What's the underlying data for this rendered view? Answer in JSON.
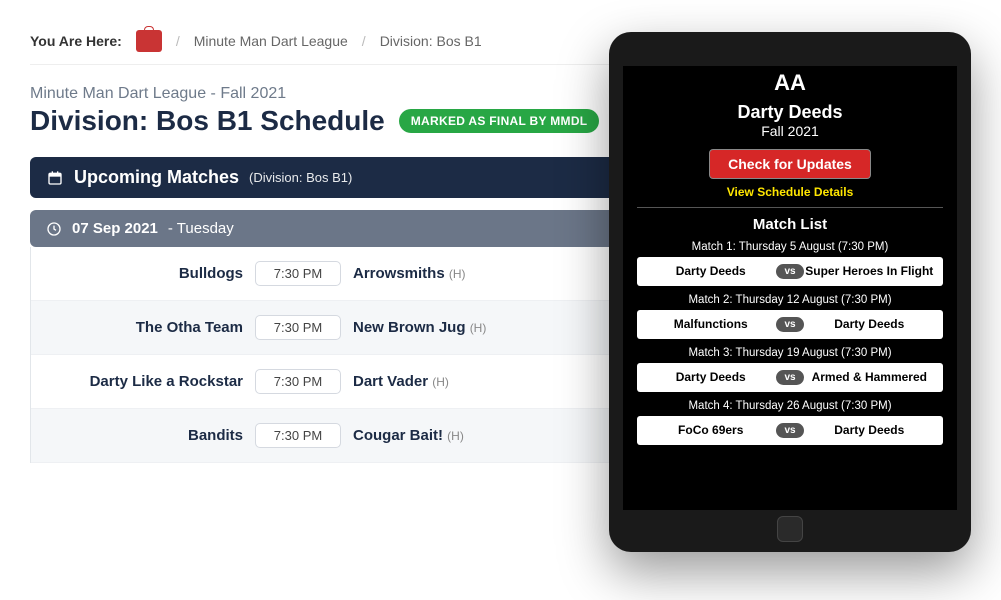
{
  "breadcrumb": {
    "you_here": "You Are Here:",
    "league": "Minute Man Dart League",
    "division": "Division: Bos B1"
  },
  "page": {
    "subtitle": "Minute Man Dart League - Fall 2021",
    "title": "Division: Bos B1 Schedule",
    "final_badge": "MARKED AS FINAL BY MMDL"
  },
  "section": {
    "heading": "Upcoming Matches",
    "heading_sub": "(Division: Bos B1)"
  },
  "date_bar": {
    "date": "07 Sep 2021",
    "day": "- Tuesday"
  },
  "matches": [
    {
      "away": "Bulldogs",
      "time": "7:30 PM",
      "home": "Arrowsmiths",
      "h": "(H)"
    },
    {
      "away": "The Otha Team",
      "time": "7:30 PM",
      "home": "New Brown Jug",
      "h": "(H)"
    },
    {
      "away": "Darty Like a Rockstar",
      "time": "7:30 PM",
      "home": "Dart Vader",
      "h": "(H)"
    },
    {
      "away": "Bandits",
      "time": "7:30 PM",
      "home": "Cougar Bait!",
      "h": "(H)"
    }
  ],
  "tablet": {
    "title": "AA",
    "team": "Darty Deeds",
    "season": "Fall 2021",
    "update_btn": "Check for Updates",
    "details_link": "View Schedule Details",
    "matchlist_hdr": "Match List",
    "matches": [
      {
        "label": "Match 1: Thursday 5 August (7:30 PM)",
        "left": "Darty Deeds",
        "right": "Super Heroes In Flight"
      },
      {
        "label": "Match 2: Thursday 12 August (7:30 PM)",
        "left": "Malfunctions",
        "right": "Darty Deeds"
      },
      {
        "label": "Match 3: Thursday 19 August (7:30 PM)",
        "left": "Darty Deeds",
        "right": "Armed & Hammered"
      },
      {
        "label": "Match 4: Thursday 26 August (7:30 PM)",
        "left": "FoCo 69ers",
        "right": "Darty Deeds"
      }
    ],
    "vs": "vs"
  }
}
